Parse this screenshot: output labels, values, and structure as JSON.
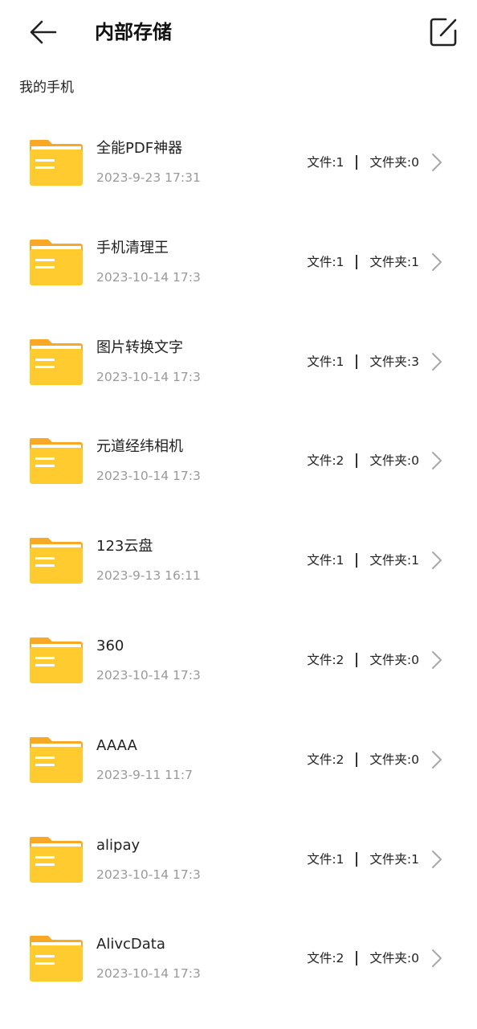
{
  "header": {
    "title": "内部存储",
    "back_icon": "arrow-left-icon",
    "edit_icon": "edit-square-icon"
  },
  "breadcrumb": "我的手机",
  "colors": {
    "folder_back": "#F9A825",
    "folder_front": "#FFCB2E",
    "date_text": "#9a9a9a"
  },
  "folders": [
    {
      "name": "全能PDF神器",
      "date": "2023-9-23 17:31",
      "files": "文件:1",
      "subfolders": "文件夹:0"
    },
    {
      "name": "手机清理王",
      "date": "2023-10-14 17:3",
      "files": "文件:1",
      "subfolders": "文件夹:1"
    },
    {
      "name": "图片转换文字",
      "date": "2023-10-14 17:3",
      "files": "文件:1",
      "subfolders": "文件夹:3"
    },
    {
      "name": "元道经纬相机",
      "date": "2023-10-14 17:3",
      "files": "文件:2",
      "subfolders": "文件夹:0"
    },
    {
      "name": "123云盘",
      "date": "2023-9-13 16:11",
      "files": "文件:1",
      "subfolders": "文件夹:1"
    },
    {
      "name": "360",
      "date": "2023-10-14 17:3",
      "files": "文件:2",
      "subfolders": "文件夹:0"
    },
    {
      "name": "AAAA",
      "date": "2023-9-11 11:7",
      "files": "文件:2",
      "subfolders": "文件夹:0"
    },
    {
      "name": "alipay",
      "date": "2023-10-14 17:3",
      "files": "文件:1",
      "subfolders": "文件夹:1"
    },
    {
      "name": "AlivcData",
      "date": "2023-10-14 17:3",
      "files": "文件:2",
      "subfolders": "文件夹:0"
    }
  ]
}
